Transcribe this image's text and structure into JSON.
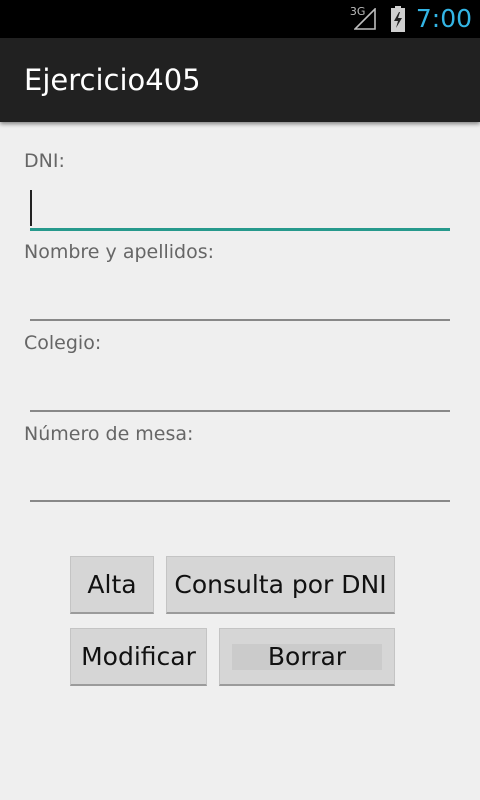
{
  "status_bar": {
    "network": "3G",
    "time": "7:00",
    "signal_icon": "signal-icon",
    "battery_icon": "battery-charging-icon"
  },
  "action_bar": {
    "title": "Ejercicio405"
  },
  "form": {
    "dni": {
      "label": "DNI:",
      "value": ""
    },
    "nombre": {
      "label": "Nombre y apellidos:",
      "value": ""
    },
    "colegio": {
      "label": "Colegio:",
      "value": ""
    },
    "mesa": {
      "label": "Número de mesa:",
      "value": ""
    }
  },
  "buttons": {
    "alta": "Alta",
    "consulta": "Consulta por DNI",
    "modificar": "Modificar",
    "borrar": "Borrar"
  },
  "colors": {
    "accent": "#33b5e5",
    "focus_underline": "#26998c",
    "action_bar": "#212121",
    "background": "#efefef"
  }
}
